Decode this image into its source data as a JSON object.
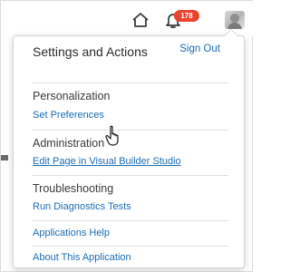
{
  "topbar": {
    "home_icon": "home-icon",
    "bell_icon": "bell-icon",
    "notification_count": "178",
    "avatar_icon": "user-avatar"
  },
  "menu": {
    "title": "Settings and Actions",
    "sign_out": "Sign Out",
    "sections": {
      "personalization": {
        "label": "Personalization",
        "link": "Set Preferences"
      },
      "administration": {
        "label": "Administration",
        "link": "Edit Page in Visual Builder Studio"
      },
      "troubleshooting": {
        "label": "Troubleshooting",
        "link": "Run Diagnostics Tests"
      }
    },
    "applications_help": "Applications Help",
    "about": "About This Application"
  },
  "colors": {
    "link": "#1a6cb7",
    "badge": "#e8442c",
    "text": "#2b2b2b"
  }
}
